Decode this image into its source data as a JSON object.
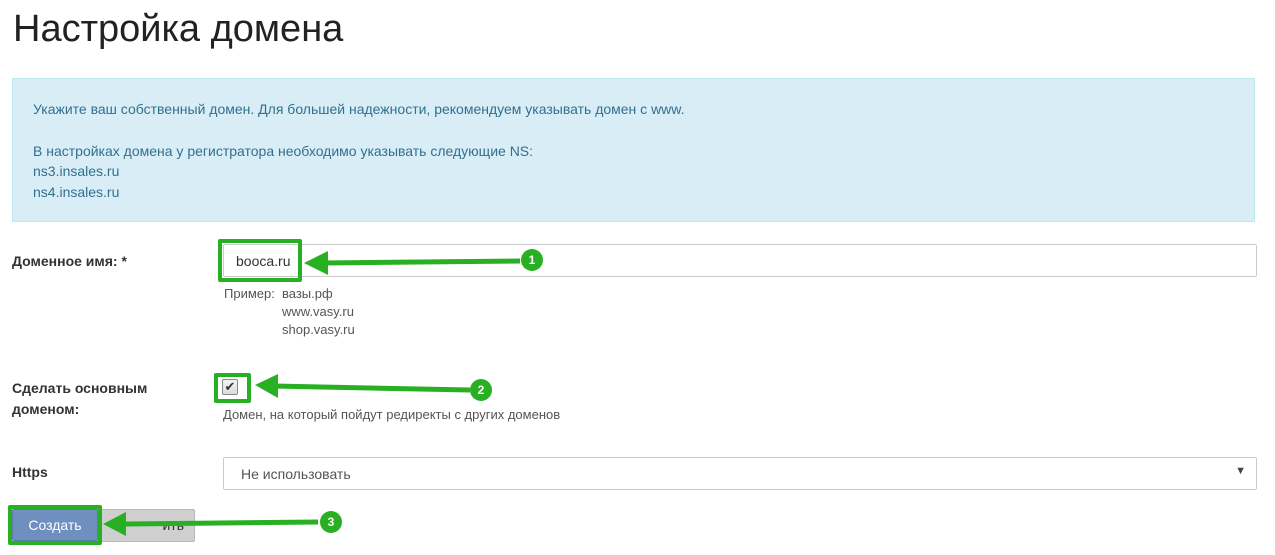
{
  "page": {
    "title": "Настройка домена"
  },
  "info": {
    "line1": "Укажите ваш собственный домен. Для большей надежности, рекомендуем указывать домен с www.",
    "line2": "В настройках домена у регистратора необходимо указывать следующие NS:",
    "ns1": "ns3.insales.ru",
    "ns2": "ns4.insales.ru"
  },
  "domain": {
    "label": "Доменное имя: *",
    "value": "booca.ru",
    "example_label": "Пример:",
    "examples": [
      "вазы.рф",
      "www.vasy.ru",
      "shop.vasy.ru"
    ]
  },
  "primary": {
    "label_line1": "Сделать основным",
    "label_line2": "доменом:",
    "checked": true,
    "hint": "Домен, на который пойдут редиректы с других доменов"
  },
  "https": {
    "label": "Https",
    "selected": "Не использовать"
  },
  "buttons": {
    "create": "Создать",
    "secondary_partial": "ить"
  },
  "annotations": {
    "marker1": "1",
    "marker2": "2",
    "marker3": "3",
    "color": "#28b022"
  }
}
